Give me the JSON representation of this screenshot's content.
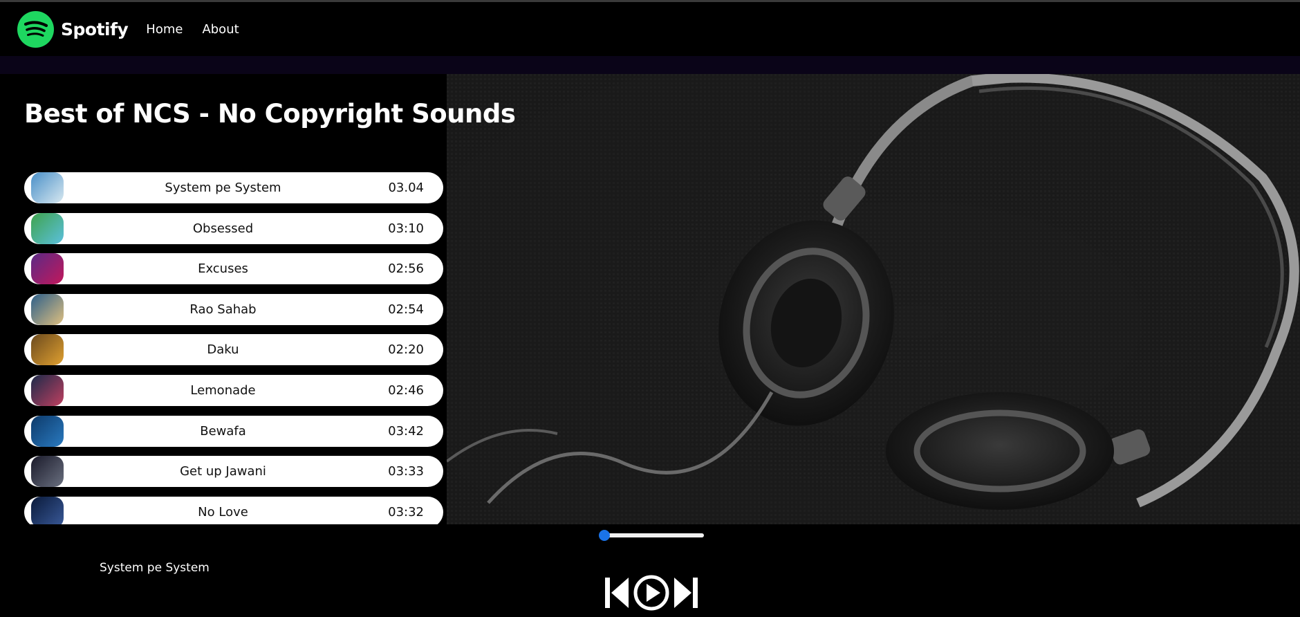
{
  "nav": {
    "brand": "Spotify",
    "links": [
      "Home",
      "About"
    ],
    "brand_color": "#1ed760"
  },
  "playlist": {
    "title": "Best of NCS - No Copyright Sounds"
  },
  "songs": [
    {
      "name": "System pe System",
      "duration": "03.04",
      "cover_colors": [
        "#4a90c8",
        "#d8e8f0"
      ]
    },
    {
      "name": "Obsessed",
      "duration": "03:10",
      "cover_colors": [
        "#3fa34d",
        "#5bc0de"
      ]
    },
    {
      "name": "Excuses",
      "duration": "02:56",
      "cover_colors": [
        "#5b2a86",
        "#c2185b"
      ]
    },
    {
      "name": "Rao Sahab",
      "duration": "02:54",
      "cover_colors": [
        "#2c5f8a",
        "#e0c080"
      ]
    },
    {
      "name": "Daku",
      "duration": "02:20",
      "cover_colors": [
        "#6b4a1e",
        "#e0a030"
      ]
    },
    {
      "name": "Lemonade",
      "duration": "02:46",
      "cover_colors": [
        "#1b2a4a",
        "#c04060"
      ]
    },
    {
      "name": "Bewafa",
      "duration": "03:42",
      "cover_colors": [
        "#0d3a6a",
        "#2a7ac0"
      ]
    },
    {
      "name": "Get up Jawani",
      "duration": "03:33",
      "cover_colors": [
        "#1a1a2a",
        "#6a7080"
      ]
    },
    {
      "name": "No Love",
      "duration": "03:32",
      "cover_colors": [
        "#0a1a3a",
        "#3a5a9a"
      ]
    }
  ],
  "player": {
    "now_playing": "System pe System",
    "progress": 0,
    "accent": "#1a73e8"
  }
}
